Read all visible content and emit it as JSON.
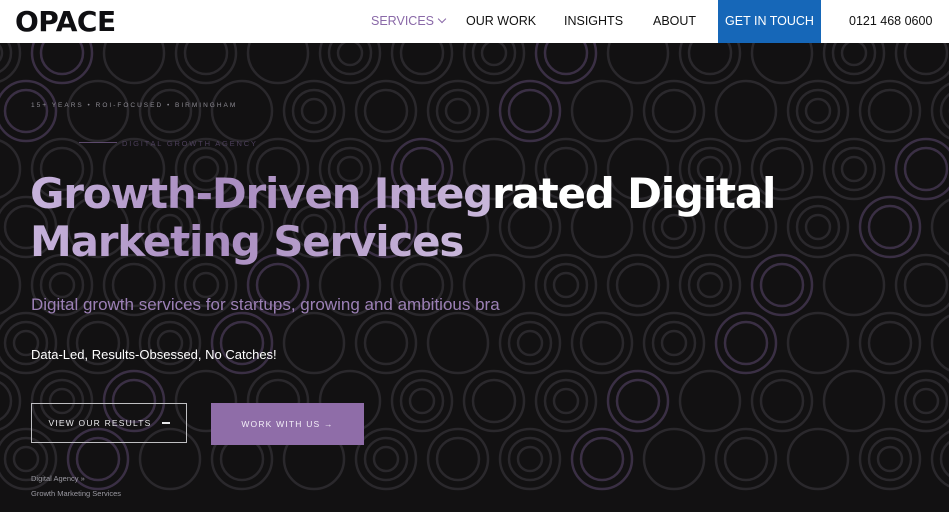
{
  "header": {
    "logo": "OPACE",
    "nav": {
      "services": "SERVICES",
      "our_work": "OUR WORK",
      "insights": "INSIGHTS",
      "about": "ABOUT"
    },
    "cta": "GET IN TOUCH",
    "phone": "0121 468 0600"
  },
  "hero": {
    "eyebrow": "15+ YEARS • ROI-FOCUSED • BIRMINGHAM",
    "agency_label": "DIGITAL GROWTH AGENCY",
    "headline": {
      "part1": "Growth-Driven Integ",
      "part2": "rated Digital",
      "line2": "Marketing Services"
    },
    "subtitle": "Digital growth services for startups, growing and ambitious bra",
    "tagline": "Data-Led, Results-Obsessed, No Catches!",
    "buttons": {
      "view_results": "VIEW OUR RESULTS",
      "work_with_us": "WORK WITH US →"
    },
    "breadcrumb": {
      "parent": "Digital Agency »",
      "current": "Growth Marketing Services"
    }
  },
  "colors": {
    "accent_purple": "#8f6da8",
    "cta_blue": "#1667b8",
    "background": "#121112"
  }
}
